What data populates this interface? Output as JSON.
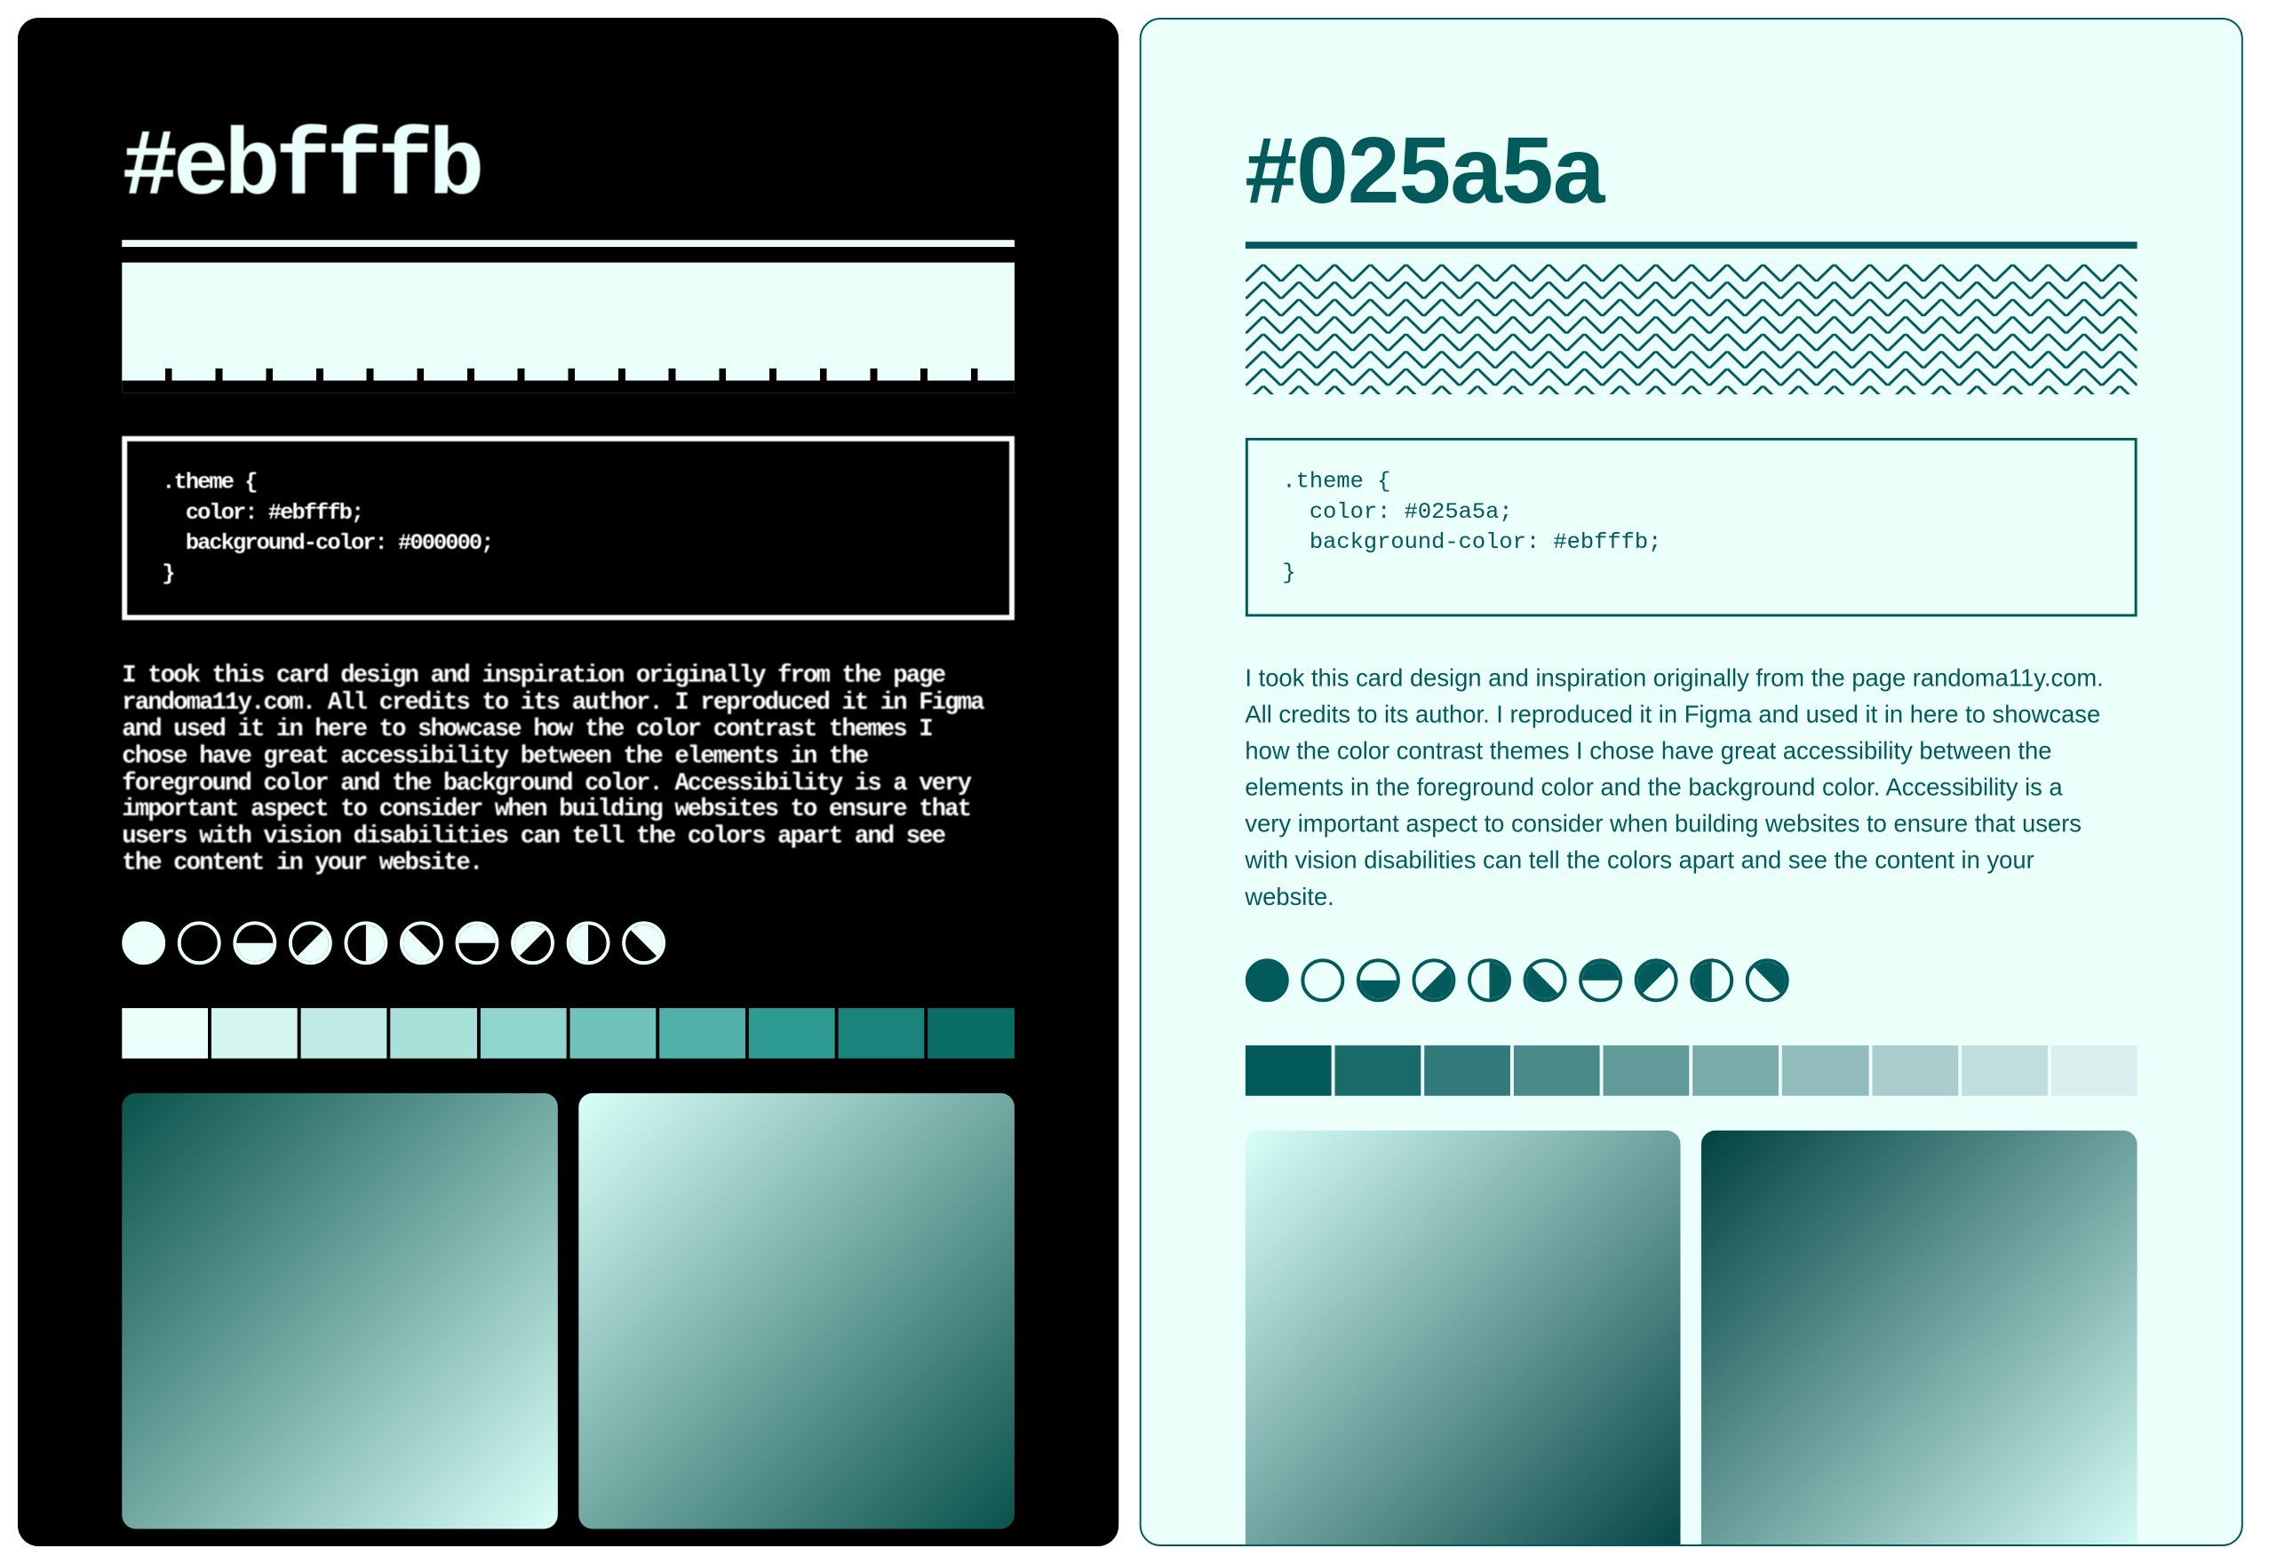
{
  "left": {
    "title": "#ebfffb",
    "code": ".theme {\n  color: #ebfffb;\n  background-color: #000000;\n}",
    "paragraph": "I took this card design and inspiration originally from the page randoma11y.com. All credits to its author. I reproduced it in Figma and used it in here to showcase how the color contrast themes I chose have great accessibility between the elements in the foreground color and the background color. Accessibility is a very important aspect to consider when building websites to ensure that users with vision disabilities can tell the colors apart and see the content in your website.",
    "fg": "#ebfffb",
    "bg": "#000000",
    "swatches": [
      "#ebfffb",
      "#d5f5f0",
      "#bfeae5",
      "#a8e0da",
      "#8fd4cd",
      "#6fc3bb",
      "#4fb1a8",
      "#2e9b92",
      "#1a847c",
      "#0a6e67"
    ],
    "gradients": [
      "linear-gradient(135deg, #0a524c 0%, #d9fff8 100%)",
      "linear-gradient(135deg, #d9fff8 0%, #0a524c 100%)"
    ]
  },
  "right": {
    "title": "#025a5a",
    "code": ".theme {\n  color: #025a5a;\n  background-color: #ebfffb;\n}",
    "paragraph": "I took this card design and inspiration originally from the page randoma11y.com. All credits to its author. I reproduced it in Figma and used it in here to showcase how the color contrast themes I chose have great accessibility between the elements in the foreground color and the background color. Accessibility is a very important aspect to consider when building websites to ensure that users with vision disabilities can tell the colors apart and see the content in your website.",
    "fg": "#025a5a",
    "bg": "#ebfffb",
    "swatches": [
      "#025a5a",
      "#1a6a6a",
      "#327a7a",
      "#4a8a8a",
      "#629a9a",
      "#7aabab",
      "#92bbbb",
      "#aacccc",
      "#c2dddd",
      "#daeeee"
    ],
    "gradients": [
      "linear-gradient(135deg, #d9fff8 0%, #014242 100%)",
      "linear-gradient(135deg, #014242 0%, #d9fff8 100%)"
    ]
  },
  "circle_variants": [
    "full",
    "empty",
    "half-bottom",
    "diag-br",
    "half-right",
    "diag-bl",
    "half-top",
    "diag-tr",
    "half-left",
    "diag-tl"
  ]
}
